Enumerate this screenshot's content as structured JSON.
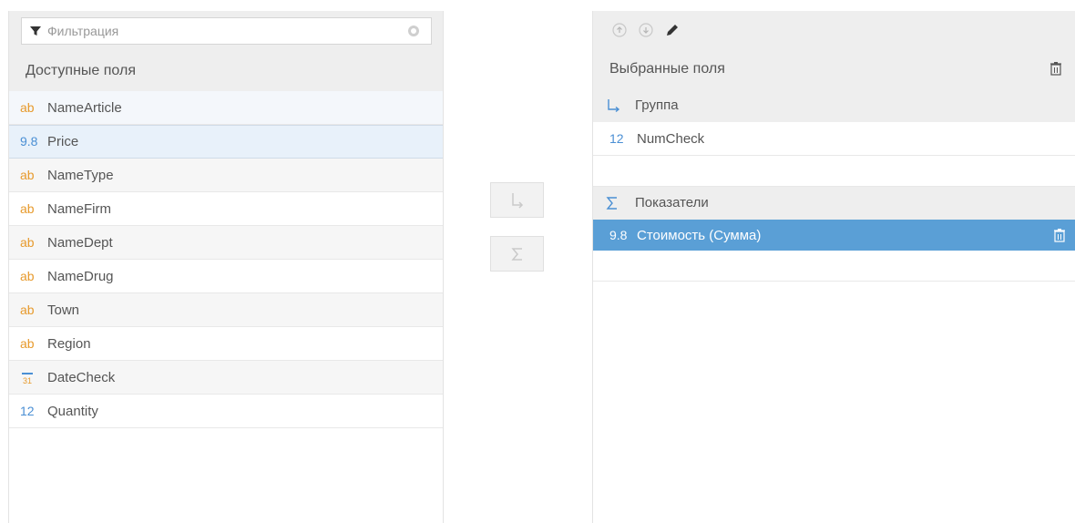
{
  "left_panel": {
    "filter_placeholder": "Фильтрация",
    "header": "Доступные поля",
    "fields": [
      {
        "type": "ab",
        "name": "NameArticle"
      },
      {
        "type": "9.8",
        "name": "Price"
      },
      {
        "type": "ab",
        "name": "NameType"
      },
      {
        "type": "ab",
        "name": "NameFirm"
      },
      {
        "type": "ab",
        "name": "NameDept"
      },
      {
        "type": "ab",
        "name": "NameDrug"
      },
      {
        "type": "ab",
        "name": "Town"
      },
      {
        "type": "ab",
        "name": "Region"
      },
      {
        "type": "31",
        "name": "DateCheck"
      },
      {
        "type": "12",
        "name": "Quantity"
      }
    ]
  },
  "middle_buttons": [
    {
      "icon": "group-arrow-icon"
    },
    {
      "icon": "sigma-icon"
    }
  ],
  "right_panel": {
    "toolbar": [
      "up-icon",
      "down-icon",
      "pencil-icon"
    ],
    "header": "Выбранные поля",
    "group_section": {
      "label": "Группа",
      "fields": [
        {
          "type": "12",
          "name": "NumCheck"
        }
      ]
    },
    "measures_section": {
      "label": "Показатели",
      "fields": [
        {
          "type": "9.8",
          "name": "Стоимость (Сумма)",
          "selected": true
        }
      ]
    }
  },
  "colors": {
    "accent": "#5a9fd6",
    "string_type": "#e79a2c",
    "number_type": "#4a8fd4",
    "header_bg": "#eeeeee"
  }
}
